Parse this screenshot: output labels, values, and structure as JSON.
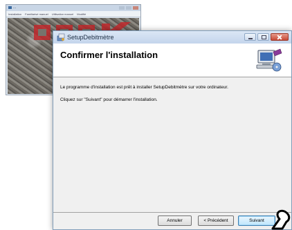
{
  "background_window": {
    "title": "...",
    "menu": [
      "Installation",
      "Familiarisé manuel",
      "Utilisation manuel",
      "Modifié"
    ]
  },
  "dialog": {
    "title": "SetupDebitmètre",
    "heading": "Confirmer l'installation",
    "message_1": "Le programme d'installation est prêt à installer SetupDebitmètre sur votre ordinateur.",
    "message_2": "Cliquez sur \"Suivant\" pour démarrer l'installation.",
    "buttons": {
      "cancel": "Annuler",
      "previous": "< Précédent",
      "next": "Suivant"
    }
  },
  "colors": {
    "dialog_bg": "#f0f0f0",
    "header_bg": "#ffffff",
    "titlebar": "#c3d5ec",
    "close_button": "#c74a37",
    "logo_red": "#c0282b"
  },
  "icons": [
    "setup-app-icon",
    "computer-install-icon",
    "minimize-icon",
    "maximize-icon",
    "close-icon",
    "mouse-cursor-icon"
  ]
}
